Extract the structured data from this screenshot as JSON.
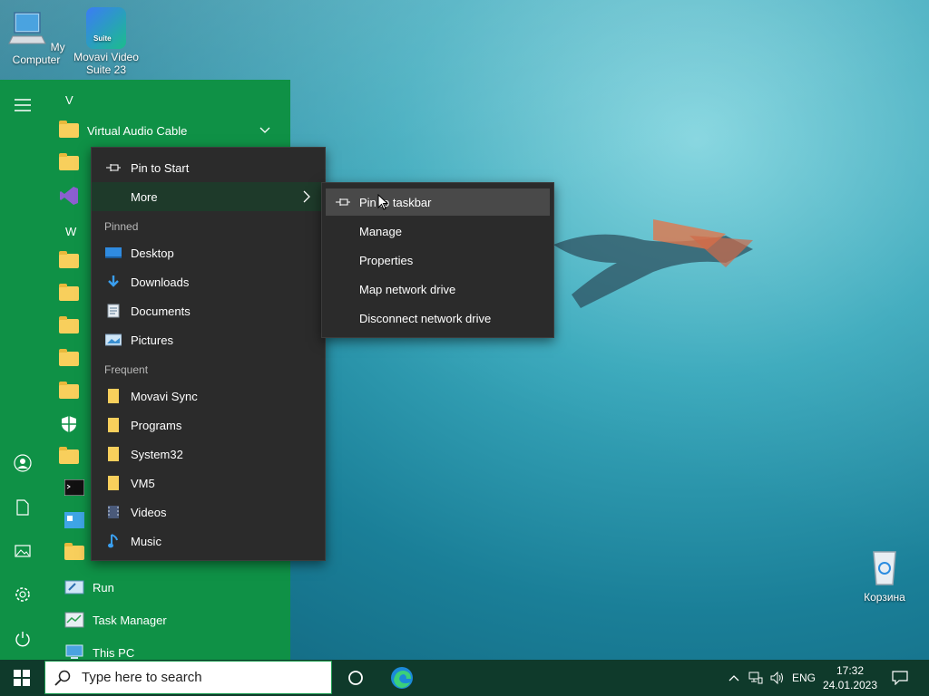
{
  "desktop": {
    "icons": [
      {
        "label": "My Computer",
        "icon": "computer-icon"
      },
      {
        "label": "Movavi Video Suite 23",
        "icon": "movavi-icon",
        "badge": "Suite"
      },
      {
        "label": "Корзина",
        "icon": "recycle-bin-icon"
      }
    ]
  },
  "start_menu": {
    "rail": [
      "hamburger-icon",
      "user-icon",
      "document-icon",
      "pictures-icon",
      "settings-icon",
      "power-icon"
    ],
    "letters": [
      "V",
      "W"
    ],
    "apps": [
      {
        "label": "Virtual Audio Cable",
        "icon": "folder-icon",
        "expandable": true
      },
      {
        "label": "Run",
        "icon": "run-icon"
      },
      {
        "label": "Task Manager",
        "icon": "task-manager-icon"
      },
      {
        "label": "This PC",
        "icon": "this-pc-icon"
      }
    ]
  },
  "context_menu": {
    "pin_to_start": "Pin to Start",
    "more": "More",
    "pinned_header": "Pinned",
    "pinned": [
      {
        "label": "Desktop",
        "icon": "desktop-icon"
      },
      {
        "label": "Downloads",
        "icon": "downloads-icon"
      },
      {
        "label": "Documents",
        "icon": "documents-icon"
      },
      {
        "label": "Pictures",
        "icon": "pictures-icon"
      }
    ],
    "frequent_header": "Frequent",
    "frequent": [
      {
        "label": "Movavi Sync",
        "icon": "folder-icon"
      },
      {
        "label": "Programs",
        "icon": "folder-icon"
      },
      {
        "label": "System32",
        "icon": "folder-icon"
      },
      {
        "label": "VM5",
        "icon": "folder-icon"
      },
      {
        "label": "Videos",
        "icon": "videos-icon"
      },
      {
        "label": "Music",
        "icon": "music-icon"
      }
    ]
  },
  "submenu": {
    "items": [
      {
        "label": "Pin to taskbar",
        "icon": "pin-icon"
      },
      {
        "label": "Manage"
      },
      {
        "label": "Properties"
      },
      {
        "label": "Map network drive"
      },
      {
        "label": "Disconnect network drive"
      }
    ]
  },
  "taskbar": {
    "search_placeholder": "Type here to search",
    "language": "ENG",
    "time": "17:32",
    "date": "24.01.2023"
  },
  "colors": {
    "start_bg": "#0f9146",
    "taskbar_bg": "#0f3a2b",
    "menu_bg": "#2b2b2b",
    "menu_highlight": "#494949"
  }
}
